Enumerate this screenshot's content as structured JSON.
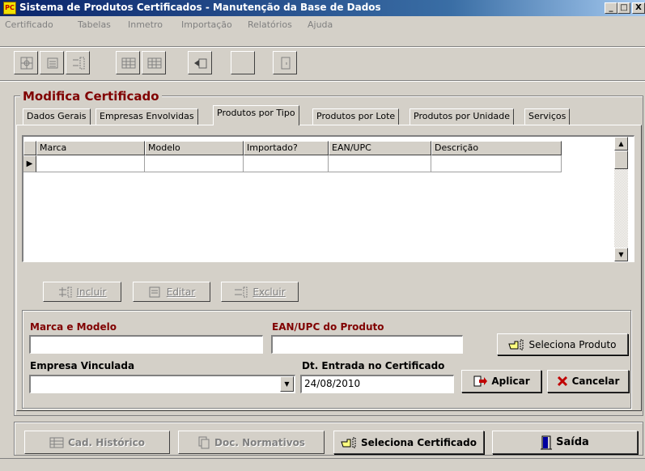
{
  "window": {
    "title": "Sistema de Produtos Certificados - Manutenção da Base de Dados",
    "controls": [
      "_",
      "□",
      "X"
    ]
  },
  "menu": [
    "Certificado",
    "Tabelas",
    "Inmetro",
    "Importação",
    "Relatórios",
    "Ajuda"
  ],
  "toolbar": {
    "buttons": [
      "new-certificate-icon",
      "edit-certificate-icon",
      "delete-certificate-icon",
      "grid-icon",
      "grid-icon",
      "import-icon",
      "blank",
      "exit-door-icon"
    ]
  },
  "form": {
    "title": "Modifica Certificado"
  },
  "tabs": [
    {
      "label": "Dados Gerais",
      "active": false
    },
    {
      "label": "Empresas Envolvidas",
      "active": false
    },
    {
      "label": "Produtos por Tipo",
      "active": true
    },
    {
      "label": "Produtos por Lote",
      "active": false
    },
    {
      "label": "Produtos por Unidade",
      "active": false
    },
    {
      "label": "Serviços",
      "active": false
    }
  ],
  "grid": {
    "columns": [
      "Marca",
      "Modelo",
      "Importado?",
      "EAN/UPC",
      "Descrição"
    ],
    "rows": [
      [
        "",
        "",
        "",
        "",
        ""
      ]
    ],
    "row_indicator": "▶"
  },
  "grid_buttons": {
    "incluir": "Incluir",
    "editar": "Editar",
    "excluir": "Excluir"
  },
  "fields": {
    "marca_modelo": {
      "label": "Marca e Modelo",
      "value": ""
    },
    "ean_upc": {
      "label": "EAN/UPC do Produto",
      "value": ""
    },
    "seleciona_produto": "Seleciona Produto",
    "empresa_vinculada": {
      "label": "Empresa Vinculada",
      "value": ""
    },
    "dt_entrada": {
      "label": "Dt. Entrada no Certificado",
      "value": "24/08/2010"
    },
    "aplicar": "Aplicar",
    "cancelar": "Cancelar"
  },
  "bottom_buttons": {
    "cad_historico": "Cad. Histórico",
    "doc_normativos": "Doc. Normativos",
    "seleciona_certificado": "Seleciona Certificado",
    "saida": "Saída"
  },
  "colors": {
    "title_bar": "#0a246a",
    "label_red": "#800000",
    "face": "#d4d0c8"
  }
}
